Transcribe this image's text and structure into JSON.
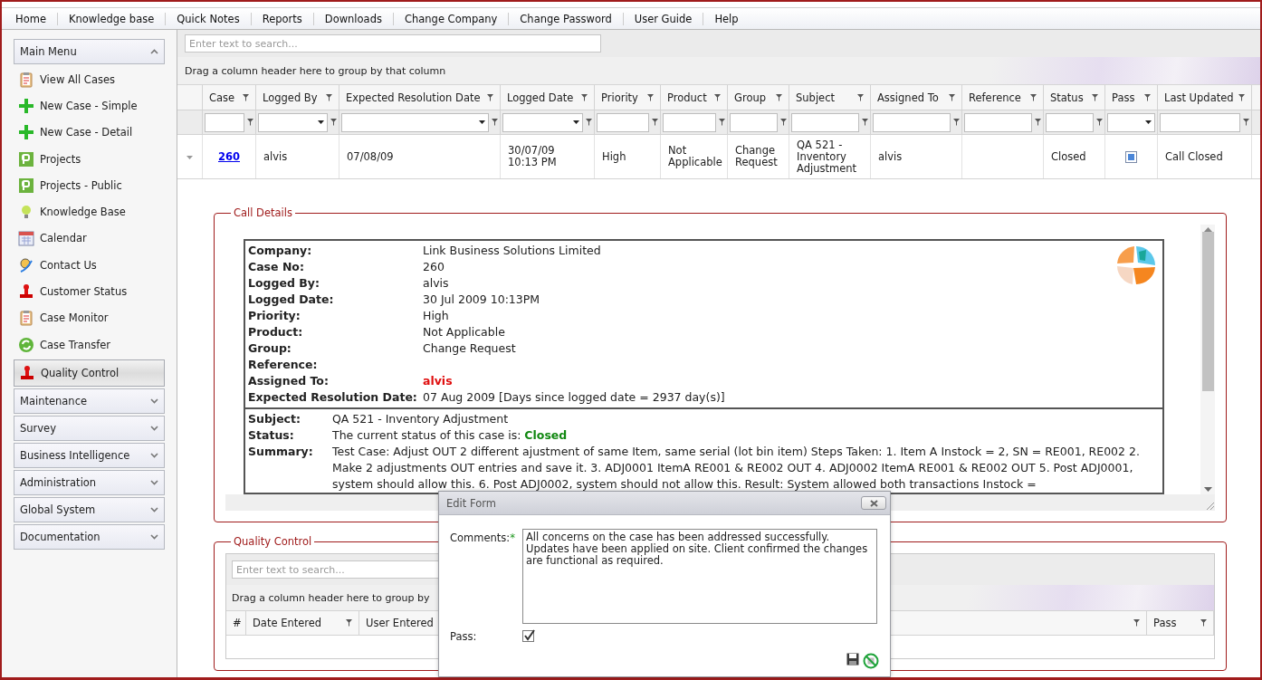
{
  "top_menu": [
    "Home",
    "Knowledge base",
    "Quick Notes",
    "Reports",
    "Downloads",
    "Change Company",
    "Change Password",
    "User Guide",
    "Help"
  ],
  "sidebar": {
    "main_menu": {
      "title": "Main Menu",
      "expanded": true,
      "items": [
        {
          "label": "View All Cases",
          "kind": "clipboard",
          "selected": false
        },
        {
          "label": "New Case - Simple",
          "kind": "plus",
          "selected": false
        },
        {
          "label": "New Case - Detail",
          "kind": "plus",
          "selected": false
        },
        {
          "label": "Projects",
          "kind": "project",
          "selected": false
        },
        {
          "label": "Projects - Public",
          "kind": "project",
          "selected": false
        },
        {
          "label": "Knowledge Base",
          "kind": "bulb",
          "selected": false
        },
        {
          "label": "Calendar",
          "kind": "calendar",
          "selected": false
        },
        {
          "label": "Contact Us",
          "kind": "contact",
          "selected": false
        },
        {
          "label": "Customer Status",
          "kind": "stamp",
          "selected": false
        },
        {
          "label": "Case Monitor",
          "kind": "clipboard",
          "selected": false
        },
        {
          "label": "Case Transfer",
          "kind": "transfer",
          "selected": false
        },
        {
          "label": "Quality Control",
          "kind": "stamp",
          "selected": true
        }
      ]
    },
    "sections": [
      {
        "title": "Maintenance",
        "expanded": false
      },
      {
        "title": "Survey",
        "expanded": false
      },
      {
        "title": "Business Intelligence",
        "expanded": false
      },
      {
        "title": "Administration",
        "expanded": false
      },
      {
        "title": "Global System",
        "expanded": false
      },
      {
        "title": "Documentation",
        "expanded": false
      }
    ]
  },
  "grid": {
    "search": {
      "placeholder": "Enter text to search..."
    },
    "group_hint": "Drag a column header here to group by that column",
    "columns": [
      {
        "label": "Case",
        "kind": "text"
      },
      {
        "label": "Logged By",
        "kind": "combo"
      },
      {
        "label": "Expected Resolution Date",
        "kind": "combo"
      },
      {
        "label": "Logged Date",
        "kind": "combo"
      },
      {
        "label": "Priority",
        "kind": "text"
      },
      {
        "label": "Product",
        "kind": "text"
      },
      {
        "label": "Group",
        "kind": "text"
      },
      {
        "label": "Subject",
        "kind": "text"
      },
      {
        "label": "Assigned To",
        "kind": "text"
      },
      {
        "label": "Reference",
        "kind": "text"
      },
      {
        "label": "Status",
        "kind": "text"
      },
      {
        "label": "Pass",
        "kind": "select"
      },
      {
        "label": "Last Updated",
        "kind": "text"
      }
    ],
    "rows": [
      {
        "expanded": true,
        "cells": [
          {
            "kind": "link",
            "text": "260"
          },
          {
            "kind": "text",
            "text": "alvis"
          },
          {
            "kind": "text",
            "text": "07/08/09"
          },
          {
            "kind": "text",
            "text": "30/07/09 10:13 PM"
          },
          {
            "kind": "text",
            "text": "High"
          },
          {
            "kind": "text",
            "text": "Not Applicable"
          },
          {
            "kind": "text",
            "text": "Change Request"
          },
          {
            "kind": "text",
            "text": "QA 521 - Inventory Adjustment"
          },
          {
            "kind": "text",
            "text": "alvis"
          },
          {
            "kind": "text",
            "text": ""
          },
          {
            "kind": "text",
            "text": "Closed"
          },
          {
            "kind": "checkbox",
            "checked": true
          },
          {
            "kind": "text",
            "text": "Call Closed"
          }
        ]
      }
    ]
  },
  "call_details": {
    "legend": "Call Details",
    "fields": [
      {
        "label": "Company:",
        "value": "Link Business Solutions Limited",
        "emphasis": false
      },
      {
        "label": "Case No:",
        "value": "260",
        "emphasis": false
      },
      {
        "label": "Logged By:",
        "value": "alvis",
        "emphasis": false
      },
      {
        "label": "Logged Date:",
        "value": "30 Jul 2009 10:13PM",
        "emphasis": false
      },
      {
        "label": "Priority:",
        "value": "High",
        "emphasis": false
      },
      {
        "label": "Product:",
        "value": "Not Applicable",
        "emphasis": false
      },
      {
        "label": "Group:",
        "value": "Change Request",
        "emphasis": false
      },
      {
        "label": "Reference:"
      },
      {
        "label": "Assigned To:",
        "value": "alvis",
        "emphasis": true
      },
      {
        "label": "Expected Resolution Date:",
        "value": "07 Aug 2009 [Days since logged date = 2937 day(s)]",
        "emphasis": false
      }
    ],
    "details": [
      {
        "label": "Subject:",
        "value": "QA 521 - Inventory Adjustment"
      },
      {
        "label": "Status:",
        "value": "The current status of this case is: **Closed**"
      },
      {
        "label": "Summary:",
        "value": "Test Case: Adjust OUT 2 different ajustment of same Item, same serial (lot bin item) Steps Taken: 1. Item A Instock = 2, SN = RE001, RE002 2. Make 2 adjustments OUT entries and save it. 3. ADJ0001 ItemA RE001 & RE002 OUT 4. ADJ0002 ItemA RE001 & RE002 OUT 5. Post ADJ0001, system should allow this. 6. Post ADJ0002, system should not allow this. Result: System allowed both transactions Instock ="
      }
    ]
  },
  "quality_control": {
    "legend": "Quality Control",
    "search": {
      "placeholder": "Enter text to search..."
    },
    "group_hint": "Drag a column header here to group by",
    "columns": [
      {
        "label": "#",
        "filter": false
      },
      {
        "label": "Date Entered",
        "filter": true
      },
      {
        "label": "User Entered"
      },
      {
        "filter": true
      },
      {
        "label": "Pass",
        "filter": true
      }
    ]
  },
  "edit_form": {
    "title": "Edit Form",
    "comments_label": "Comments:",
    "required_mark": "*",
    "comments": "All concerns on the case has been addressed successfully. Updates have been applied on site. Client confirmed the changes are functional as required.",
    "pass_label": "Pass:",
    "pass_checked": true
  }
}
